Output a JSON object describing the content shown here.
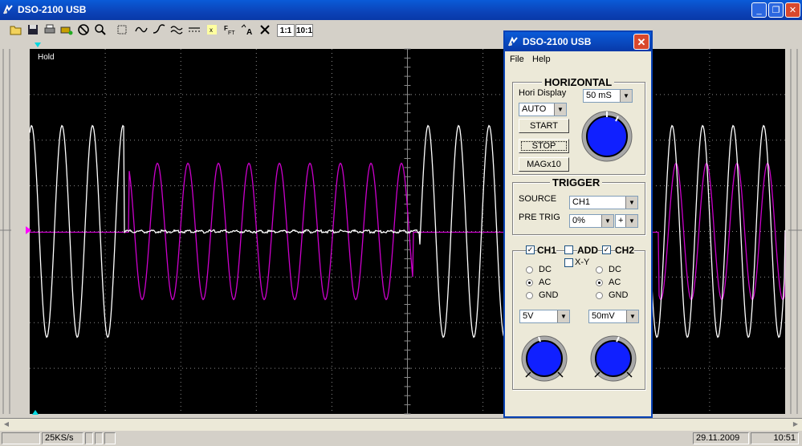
{
  "window": {
    "title": "DSO-2100 USB",
    "min_icon": "minimize-icon",
    "max_icon": "restore-icon",
    "close_icon": "close-icon"
  },
  "toolbar": {
    "icons": [
      "open-icon",
      "save-icon",
      "print-icon",
      "print-setup-icon",
      "stop-icon",
      "zoom-icon",
      "cursor-icon",
      "waveform-icon",
      "waveform-2-icon",
      "filter-icon",
      "dashed-line-icon",
      "marker-icon",
      "fft-icon",
      "text-icon",
      "cross-icon"
    ],
    "ratio_1": "1:1",
    "ratio_10": "10:1"
  },
  "scope": {
    "status_text": "Hold",
    "colors": {
      "background": "#000000",
      "grid": "#8a8a8a",
      "ch1": "#ffffff",
      "ch2": "#cc00cc",
      "marker": "#00d8e0"
    }
  },
  "panel": {
    "title": "DSO-2100 USB",
    "menu": [
      "File",
      "Help"
    ],
    "horizontal": {
      "title": "HORIZONTAL",
      "hori_display_label": "Hori Display",
      "timebase_value": "50 mS",
      "mode_value": "AUTO",
      "start_label": "START",
      "stop_label": "STOP",
      "mag_label": "MAGx10"
    },
    "trigger": {
      "title": "TRIGGER",
      "source_label": "SOURCE",
      "source_value": "CH1",
      "pretrig_label": "PRE TRIG",
      "pretrig_value": "0%",
      "slope_value": "+"
    },
    "channels": {
      "ch1_label": "CH1",
      "add_label": "ADD",
      "ch2_label": "CH2",
      "xy_label": "X-Y",
      "ch1_checked": true,
      "add_checked": false,
      "ch2_checked": true,
      "xy_checked": false,
      "coupling_options": [
        "DC",
        "AC",
        "GND"
      ],
      "ch1_coupling": "AC",
      "ch2_coupling": "AC",
      "ch1_volts": "5V",
      "ch2_volts": "50mV"
    }
  },
  "statusbar": {
    "sample_rate": "25KS/s",
    "date": "29.11.2009",
    "time": "10:51"
  }
}
